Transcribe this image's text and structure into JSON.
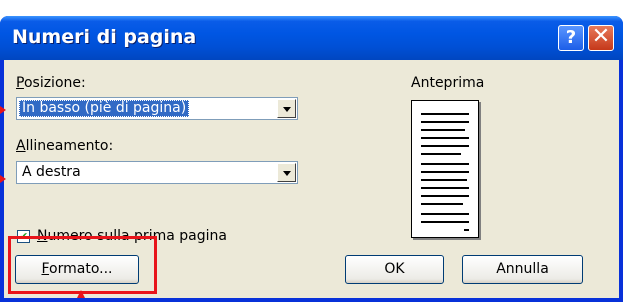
{
  "window": {
    "title": "Numeri di pagina",
    "help_glyph": "?",
    "close_glyph": "✕"
  },
  "position": {
    "label": "Posizione:",
    "label_access_key": "P",
    "label_rest": "osizione:",
    "value": "In basso (piè di pagina)"
  },
  "alignment": {
    "label": "Allineamento:",
    "label_access_key": "A",
    "label_rest": "llineamento:",
    "value": "A destra"
  },
  "first_page": {
    "label": "Numero sulla prima pagina",
    "label_access_key": "N",
    "label_rest": "umero sulla prima pagina",
    "checked": true,
    "check_glyph": "✔"
  },
  "preview": {
    "label": "Anteprima"
  },
  "buttons": {
    "format": "Formato...",
    "format_access_key": "F",
    "format_rest": "ormato...",
    "ok": "OK",
    "cancel": "Annulla"
  },
  "annotation_color": "#e8141a"
}
